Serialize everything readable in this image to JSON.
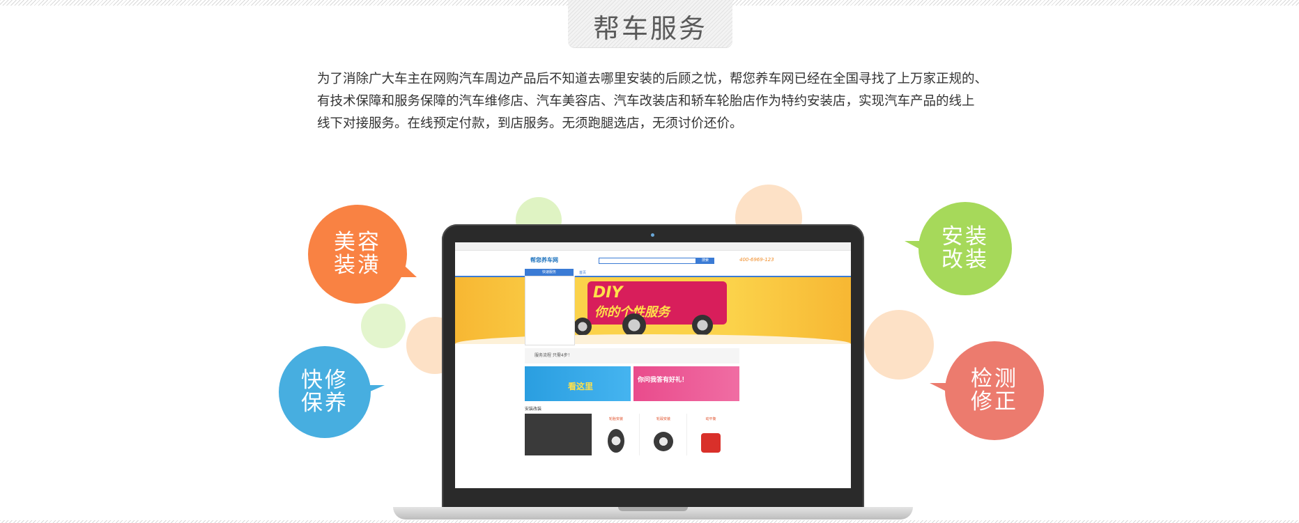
{
  "header": {
    "title": "帮车服务"
  },
  "intro": {
    "lines": [
      "为了消除广大车主在网购汽车周边产品后不知道去哪里安装的后顾之忧，帮您养车网已经在全国寻找了上万家正规的、",
      "有技术保障和服务保障的汽车维修店、汽车美容店、汽车改装店和轿车轮胎店作为特约安装店，实现汽车产品的线上",
      "线下对接服务。在线预定付款，到店服务。无须跑腿选店，无须讨价还价。"
    ]
  },
  "bubbles": {
    "beauty": {
      "line1": "美容",
      "line2": "装潢",
      "color": "#f98243"
    },
    "repair": {
      "line1": "快修",
      "line2": "保养",
      "color": "#47aee0"
    },
    "install": {
      "line1": "安装",
      "line2": "改装",
      "color": "#a6d95a"
    },
    "inspect": {
      "line1": "检测",
      "line2": "修正",
      "color": "#ec7b6e"
    }
  },
  "screen_site": {
    "logo": "帮您养车网",
    "search_button": "搜索",
    "phone": "400-6969-123",
    "category_menu": "快速服务",
    "nav_home": "首页",
    "banner_line1": "DIY",
    "banner_line2": "你的个性服务",
    "flow_text": "服务流程 只需4步！",
    "ad1_text": "看这里",
    "ad2_text": "你问我答有好礼！",
    "section_title": "安装改装",
    "products": [
      "轮胎安装",
      "轮毂安装",
      "动平衡"
    ]
  }
}
